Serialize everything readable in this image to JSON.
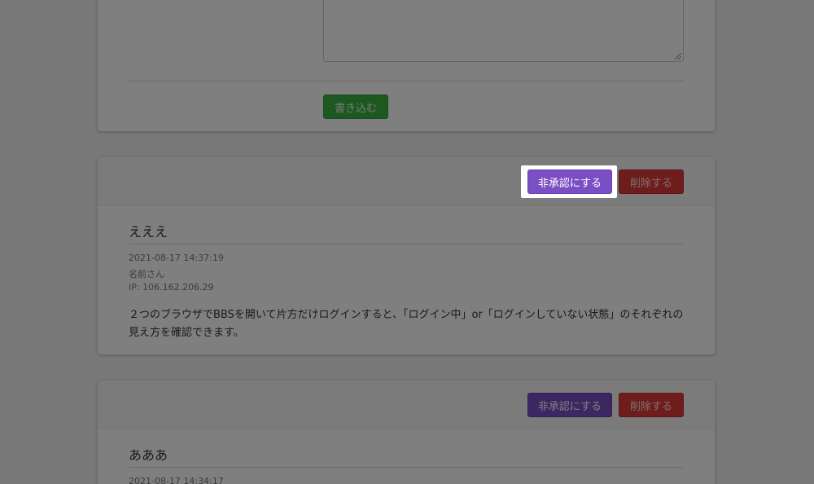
{
  "form": {
    "submit_label": "書き込む"
  },
  "posts": [
    {
      "unapprove_label": "非承認にする",
      "delete_label": "削除する",
      "title": "えええ",
      "timestamp": "2021-08-17 14:37:19",
      "author": "名前さん",
      "ip": "IP: 106.162.206.29",
      "body": "２つのブラウザでBBSを開いて片方だけログインすると、「ログイン中」or「ログインしていない状態」のそれぞれの見え方を確認できます。"
    },
    {
      "unapprove_label": "非承認にする",
      "delete_label": "削除する",
      "title": "あああ",
      "timestamp": "2021-08-17 14:34:17"
    }
  ],
  "colors": {
    "submit": "#3cb043",
    "unapprove": "#7b4fc4",
    "delete": "#dc3939",
    "overlay": "rgba(0,0,0,0.5)"
  }
}
